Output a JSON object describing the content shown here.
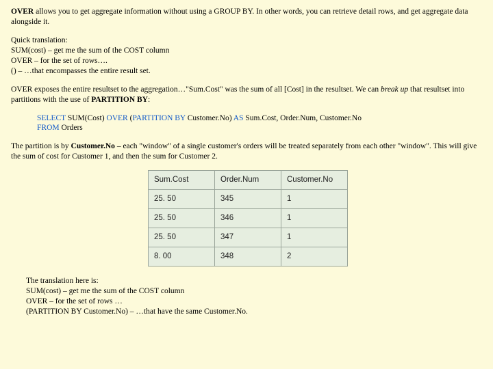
{
  "p1": {
    "strong1": "OVER",
    "t1": " allows you to get aggregate information without using a GROUP BY. In other words, you can retrieve detail rows, and get aggregate data alongside it."
  },
  "p2": {
    "l0": "Quick translation:",
    "l1": "SUM(cost) – get me the sum of the COST column",
    "l2": "OVER – for the set of rows….",
    "l3": "() – …that encompasses the entire result set."
  },
  "p3": {
    "t1": "OVER exposes the entire resultset to the aggregation…\"Sum.Cost\" was the sum of all [Cost] in the resultset. We can ",
    "em1": "break up",
    "t2": " that resultset into partitions with the use of ",
    "strong1": "PARTITION BY",
    "t3": ":"
  },
  "sql": {
    "kw1": "SELECT ",
    "f1": "SUM(Cost) ",
    "kw2": "OVER ",
    "f2": "(",
    "kw3": "PARTITION BY ",
    "f3": "Customer.No) ",
    "kw4": "AS ",
    "f4": "Sum.Cost, Order.Num, Customer.No",
    "kw5": "FROM ",
    "f5": "Orders"
  },
  "p4": {
    "t1": "The partition is by ",
    "strong1": "Customer.No",
    "t2": " – each \"window\" of a single customer's orders will be treated separately from each other \"window\". This will give the sum of cost for Customer 1, and then the sum for Customer 2."
  },
  "table": {
    "headers": [
      "Sum.Cost",
      "Order.Num",
      "Customer.No"
    ],
    "rows": [
      [
        "25. 50",
        "345",
        "1"
      ],
      [
        "25. 50",
        "346",
        "1"
      ],
      [
        "25. 50",
        "347",
        "1"
      ],
      [
        "8. 00",
        "348",
        "2"
      ]
    ]
  },
  "p5": {
    "l0": "The translation here is:",
    "l1": "SUM(cost) – get me the sum of the COST column",
    "l2": "OVER – for the set of rows …",
    "l3": "(PARTITION BY Customer.No) – …that have the same Customer.No."
  }
}
